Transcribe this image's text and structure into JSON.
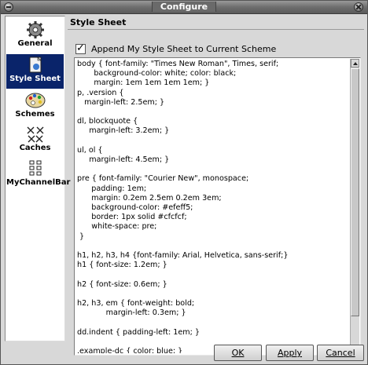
{
  "window": {
    "title": "Configure"
  },
  "sidebar": {
    "items": [
      {
        "label": "General",
        "icon": "general-gear-icon",
        "active": false
      },
      {
        "label": "Style Sheet",
        "icon": "style-sheet-icon",
        "active": true
      },
      {
        "label": "Schemes",
        "icon": "palette-icon",
        "active": false
      },
      {
        "label": "Caches",
        "icon": "caches-icon",
        "active": false
      },
      {
        "label": "MyChannelBar",
        "icon": "channel-bar-icon",
        "active": false
      }
    ]
  },
  "panel": {
    "header": "Style Sheet",
    "append_label": "Append My Style Sheet to Current Scheme",
    "append_checked": true,
    "stylesheet_text": "body { font-family: \"Times New Roman\", Times, serif;\n       background-color: white; color: black;\n       margin: 1em 1em 1em 1em; }\np, .version {\n   margin-left: 2.5em; }\n\ndl, blockquote {\n     margin-left: 3.2em; }\n\nul, ol {\n     margin-left: 4.5em; }\n\npre { font-family: \"Courier New\", monospace;\n      padding: 1em;\n      margin: 0.2em 2.5em 0.2em 3em;\n      background-color: #efeff5;\n      border: 1px solid #cfcfcf;\n      white-space: pre;\n }\n\nh1, h2, h3, h4 {font-family: Arial, Helvetica, sans-serif;}\nh1 { font-size: 1.2em; }\n\nh2 { font-size: 0.6em; }\n\nh2, h3, em { font-weight: bold;\n            margin-left: 0.3em; }\n\ndd.indent { padding-left: 1em; }\n\n.example-dc { color: blue; }"
  },
  "buttons": {
    "ok": "OK",
    "apply": "Apply",
    "cancel": "Cancel"
  }
}
